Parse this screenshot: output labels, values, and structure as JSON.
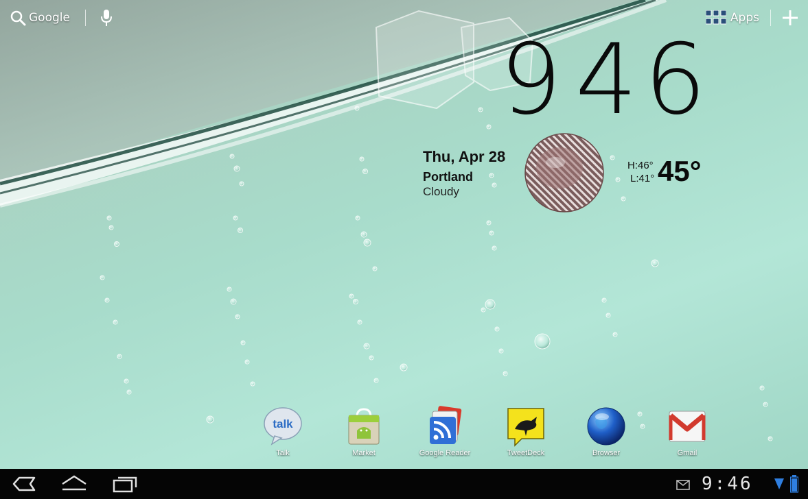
{
  "search": {
    "label": "Google"
  },
  "apps": {
    "label": "Apps"
  },
  "clock_widget": {
    "hours": "9",
    "minutes": "46"
  },
  "weather": {
    "date": "Thu, Apr 28",
    "city": "Portland",
    "condition": "Cloudy",
    "high": "H:46°",
    "low": "L:41°",
    "temperature": "45°"
  },
  "dock": [
    {
      "label": "Talk",
      "icon": "talk-icon"
    },
    {
      "label": "Market",
      "icon": "market-icon"
    },
    {
      "label": "Google Reader",
      "icon": "google-reader-icon"
    },
    {
      "label": "TweetDeck",
      "icon": "tweetdeck-icon"
    },
    {
      "label": "Browser",
      "icon": "browser-icon"
    },
    {
      "label": "Gmail",
      "icon": "gmail-icon"
    }
  ],
  "system_bar": {
    "time": "9:46"
  },
  "colors": {
    "wallpaper": "#a8dccb",
    "navbar": "#050505",
    "battery": "#2f7fe0"
  }
}
